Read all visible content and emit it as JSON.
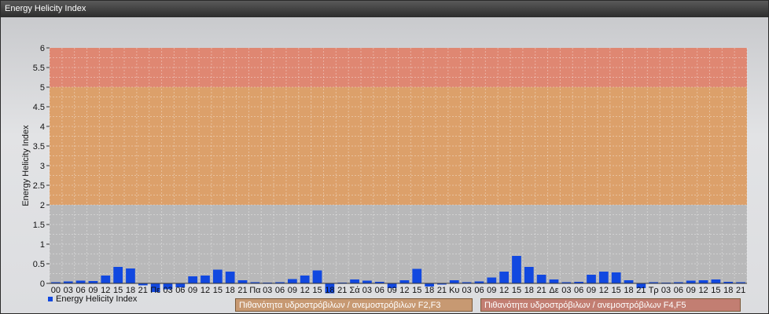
{
  "window": {
    "title": "Energy Helicity Index"
  },
  "legend": {
    "series_label": "Energy Helicity Index",
    "band_f2f3": "Πιθανότητα υδροστρόβιλων / ανεμοστρόβιλων F2,F3",
    "band_f4f5": "Πιθανότητα υδροστρόβιλων / ανεμοστρόβιλων F4,F5"
  },
  "colors": {
    "bar": "#1148e0",
    "band_low": "#b8b8b9",
    "band_mid": "#dca06a",
    "band_high": "#df8772",
    "band_legend_mid": "#c79972",
    "band_legend_high": "#c27e72"
  },
  "chart_data": {
    "type": "bar",
    "ylabel": "Energy Helicity Index",
    "ylim": [
      0,
      6
    ],
    "yticks": [
      "0",
      "0.5",
      "1",
      "1.5",
      "2",
      "2.5",
      "3",
      "3.5",
      "4",
      "4.5",
      "5",
      "5.5",
      "6"
    ],
    "bands": [
      {
        "from": 0,
        "to": 2
      },
      {
        "from": 2,
        "to": 5,
        "label": "Πιθανότητα υδροστρόβιλων / ανεμοστρόβιλων F2,F3"
      },
      {
        "from": 5,
        "to": 6,
        "label": "Πιθανότητα υδροστρόβιλων / ανεμοστρόβιλων F4,F5"
      }
    ],
    "categories": [
      "00",
      "03",
      "06",
      "09",
      "12",
      "15",
      "18",
      "21",
      "Πε",
      "03",
      "06",
      "09",
      "12",
      "15",
      "18",
      "21",
      "Πα",
      "03",
      "06",
      "09",
      "12",
      "15",
      "18",
      "21",
      "Σά",
      "03",
      "06",
      "09",
      "12",
      "15",
      "18",
      "21",
      "Κυ",
      "03",
      "06",
      "09",
      "12",
      "15",
      "18",
      "21",
      "Δε",
      "03",
      "06",
      "09",
      "12",
      "15",
      "18",
      "21",
      "Τρ",
      "03",
      "06",
      "09",
      "12",
      "15",
      "18",
      "21"
    ],
    "values": [
      0.03,
      0.05,
      0.07,
      0.06,
      0.2,
      0.42,
      0.38,
      -0.05,
      -0.22,
      -0.15,
      -0.1,
      0.18,
      0.2,
      0.35,
      0.3,
      0.08,
      0.03,
      0.02,
      0.03,
      0.11,
      0.2,
      0.33,
      -0.25,
      0.02,
      0.1,
      0.07,
      0.04,
      -0.12,
      0.08,
      0.37,
      -0.08,
      -0.03,
      0.08,
      0.03,
      0.05,
      0.15,
      0.3,
      0.7,
      0.42,
      0.22,
      0.1,
      0.03,
      0.04,
      0.22,
      0.3,
      0.28,
      0.08,
      -0.12,
      0.03,
      0.02,
      0.03,
      0.07,
      0.08,
      0.1,
      0.04,
      0.03
    ]
  }
}
